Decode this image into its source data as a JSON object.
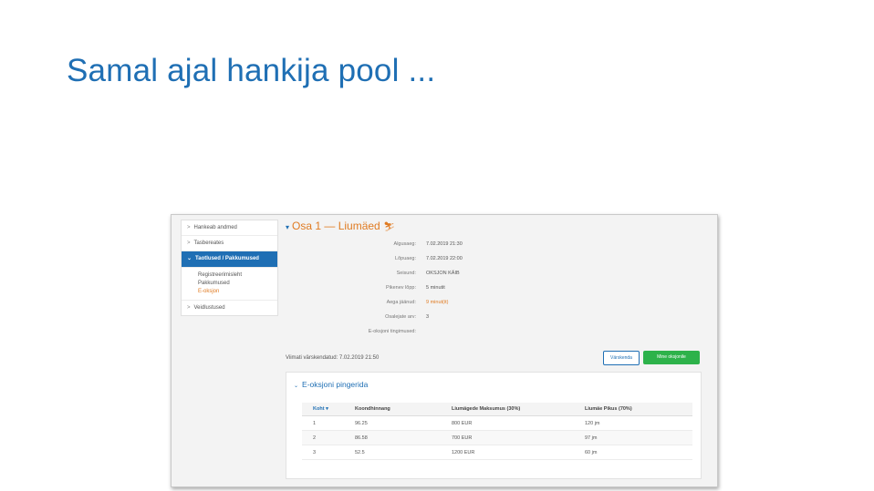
{
  "slide": {
    "title": "Samal ajal hankija pool ..."
  },
  "sidebar": {
    "items": [
      {
        "label": "Hankeab andmed"
      },
      {
        "label": "Tasbereates"
      },
      {
        "label": "Taotlused / Pakkumused"
      },
      {
        "label": "Veidlustused"
      }
    ],
    "sub_items": [
      "Registreerimisleht",
      "Pakkumused",
      "E-oksjon"
    ]
  },
  "main": {
    "section_title": "Osa 1 — Liumäed",
    "details": [
      {
        "key": "Algusaeg:",
        "value": "7.02.2019 21:30"
      },
      {
        "key": "Lõpuaeg:",
        "value": "7.02.2019 22:00"
      },
      {
        "key": "Seisund:",
        "value": "OKSJON KÄIB"
      },
      {
        "key": "Pikenev lõpp:",
        "value": "5 minutit"
      },
      {
        "key": "Aega jäänud:",
        "value": "9 minut(it)"
      },
      {
        "key": "Osalejate arv:",
        "value": "3"
      },
      {
        "key": "E-oksjoni tingimused:",
        "value": ""
      }
    ],
    "updated_text": "Viimati värskendatud: 7.02.2019 21:50",
    "refresh_button": "Värskenda",
    "go_button": "Mine oksjonile"
  },
  "ranking": {
    "title": "E-oksjoni pingerida",
    "columns": [
      "Koht",
      "Koondhinnang",
      "Liumägede Maksumus (30%)",
      "Liumäe Pikus (70%)"
    ],
    "rows": [
      [
        "1",
        "96.25",
        "800 EUR",
        "120 jm"
      ],
      [
        "2",
        "86.58",
        "700 EUR",
        "97 jm"
      ],
      [
        "3",
        "52.5",
        "1200 EUR",
        "60 jm"
      ]
    ]
  }
}
